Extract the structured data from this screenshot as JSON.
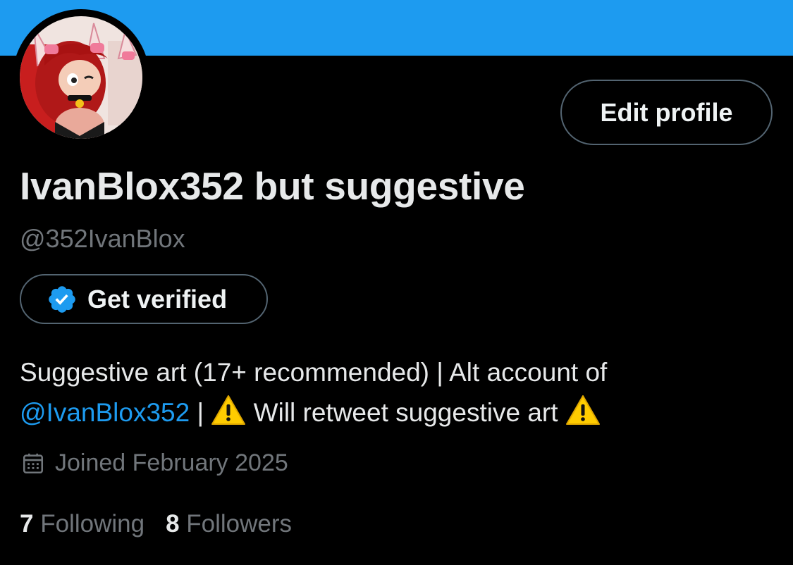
{
  "header": {
    "banner_color": "#1d9bf0"
  },
  "profile": {
    "avatar_icon": "profile-avatar",
    "edit_button_label": "Edit profile",
    "display_name": "IvanBlox352 but suggestive",
    "handle": "@352IvanBlox",
    "verify_button_label": "Get verified",
    "verify_icon": "verified-badge-icon",
    "bio": {
      "part1": "Suggestive art (17+ recommended) | Alt account of ",
      "mention": "@IvanBlox352",
      "part2": " | ",
      "part3": " Will retweet suggestive art ",
      "warning_icon": "warning-icon"
    },
    "joined_text": "Joined February 2025",
    "joined_icon": "calendar-icon",
    "following_count": "7",
    "following_label": "Following",
    "followers_count": "8",
    "followers_label": "Followers"
  },
  "colors": {
    "accent": "#1d9bf0",
    "background": "#000000",
    "primary_text": "#e7e9ea",
    "secondary_text": "#71767b",
    "border": "#536471",
    "warning": "#ffcc00"
  }
}
